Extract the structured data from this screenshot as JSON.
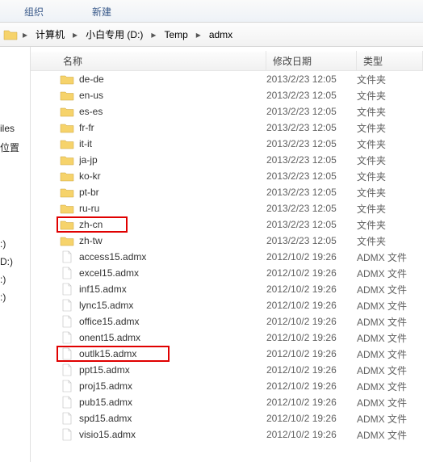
{
  "menubar": {
    "organize": "组织",
    "new": "新建"
  },
  "breadcrumb": {
    "items": [
      "计算机",
      "小白专用 (D:)",
      "Temp",
      "admx"
    ]
  },
  "sidebar": {
    "items": [
      "iles",
      "位置",
      "",
      "",
      "",
      "",
      "",
      "",
      "",
      "",
      "",
      "",
      "",
      "",
      ":)",
      "D:)",
      ":)",
      ":)"
    ]
  },
  "columns": {
    "name": "名称",
    "date": "修改日期",
    "type": "类型"
  },
  "rows": [
    {
      "icon": "folder",
      "name": "de-de",
      "date": "2013/2/23 12:05",
      "type": "文件夹"
    },
    {
      "icon": "folder",
      "name": "en-us",
      "date": "2013/2/23 12:05",
      "type": "文件夹"
    },
    {
      "icon": "folder",
      "name": "es-es",
      "date": "2013/2/23 12:05",
      "type": "文件夹"
    },
    {
      "icon": "folder",
      "name": "fr-fr",
      "date": "2013/2/23 12:05",
      "type": "文件夹"
    },
    {
      "icon": "folder",
      "name": "it-it",
      "date": "2013/2/23 12:05",
      "type": "文件夹"
    },
    {
      "icon": "folder",
      "name": "ja-jp",
      "date": "2013/2/23 12:05",
      "type": "文件夹"
    },
    {
      "icon": "folder",
      "name": "ko-kr",
      "date": "2013/2/23 12:05",
      "type": "文件夹"
    },
    {
      "icon": "folder",
      "name": "pt-br",
      "date": "2013/2/23 12:05",
      "type": "文件夹"
    },
    {
      "icon": "folder",
      "name": "ru-ru",
      "date": "2013/2/23 12:05",
      "type": "文件夹"
    },
    {
      "icon": "folder",
      "name": "zh-cn",
      "date": "2013/2/23 12:05",
      "type": "文件夹",
      "highlight": "hl1"
    },
    {
      "icon": "folder",
      "name": "zh-tw",
      "date": "2013/2/23 12:05",
      "type": "文件夹"
    },
    {
      "icon": "file",
      "name": "access15.admx",
      "date": "2012/10/2 19:26",
      "type": "ADMX 文件"
    },
    {
      "icon": "file",
      "name": "excel15.admx",
      "date": "2012/10/2 19:26",
      "type": "ADMX 文件"
    },
    {
      "icon": "file",
      "name": "inf15.admx",
      "date": "2012/10/2 19:26",
      "type": "ADMX 文件"
    },
    {
      "icon": "file",
      "name": "lync15.admx",
      "date": "2012/10/2 19:26",
      "type": "ADMX 文件"
    },
    {
      "icon": "file",
      "name": "office15.admx",
      "date": "2012/10/2 19:26",
      "type": "ADMX 文件"
    },
    {
      "icon": "file",
      "name": "onent15.admx",
      "date": "2012/10/2 19:26",
      "type": "ADMX 文件"
    },
    {
      "icon": "file",
      "name": "outlk15.admx",
      "date": "2012/10/2 19:26",
      "type": "ADMX 文件",
      "highlight": "hl2"
    },
    {
      "icon": "file",
      "name": "ppt15.admx",
      "date": "2012/10/2 19:26",
      "type": "ADMX 文件"
    },
    {
      "icon": "file",
      "name": "proj15.admx",
      "date": "2012/10/2 19:26",
      "type": "ADMX 文件"
    },
    {
      "icon": "file",
      "name": "pub15.admx",
      "date": "2012/10/2 19:26",
      "type": "ADMX 文件"
    },
    {
      "icon": "file",
      "name": "spd15.admx",
      "date": "2012/10/2 19:26",
      "type": "ADMX 文件"
    },
    {
      "icon": "file",
      "name": "visio15.admx",
      "date": "2012/10/2 19:26",
      "type": "ADMX 文件"
    }
  ]
}
